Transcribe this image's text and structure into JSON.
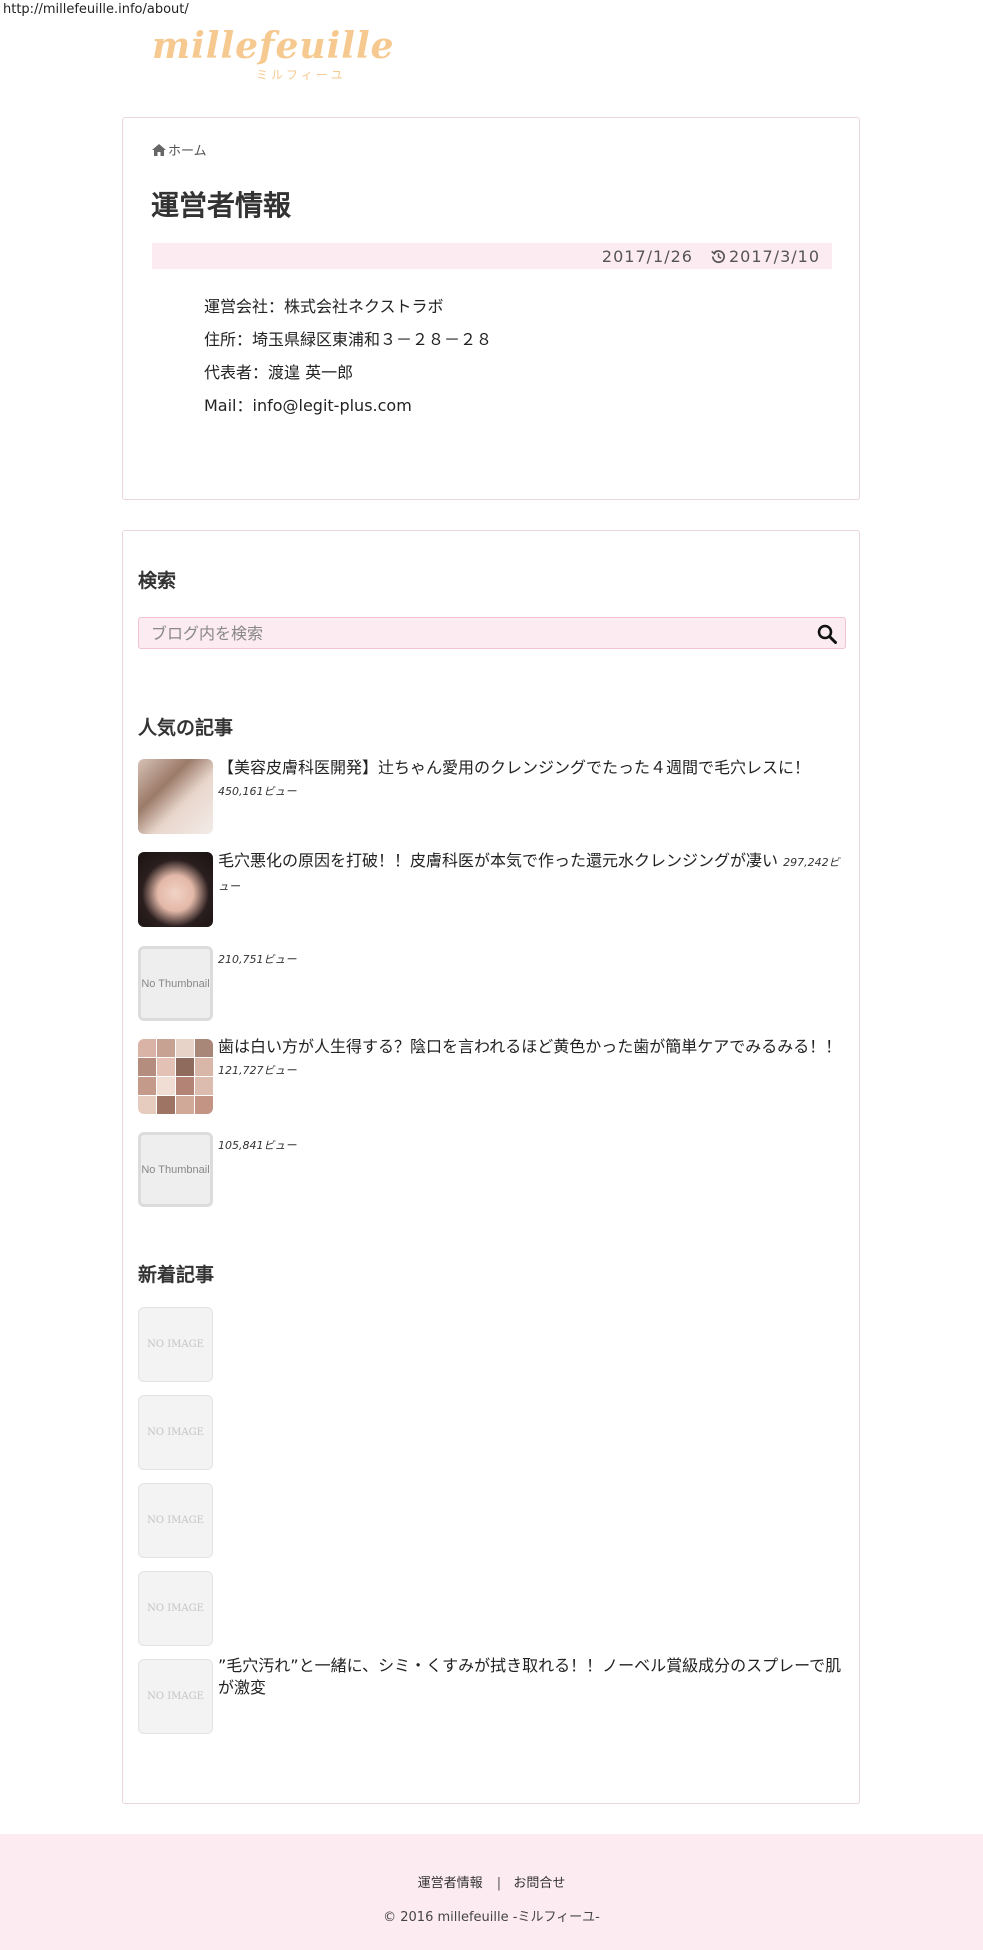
{
  "browser": {
    "url": "http://millefeuille.info/about/"
  },
  "header": {
    "logo_text": "millefeuille",
    "logo_subtitle": "ミルフィーユ"
  },
  "breadcrumb": {
    "home_label": "ホーム"
  },
  "article": {
    "title": "運営者情報",
    "published_date": "2017/1/26",
    "updated_date": "2017/3/10",
    "info": [
      "運営会社：株式会社ネクストラボ",
      "住所：埼玉県緑区東浦和３－２８－２８",
      "代表者：渡遑 英一郎",
      "Mail：info@legit-plus.com"
    ]
  },
  "sidebar": {
    "search": {
      "title": "検索",
      "placeholder": "ブログ内を検索"
    },
    "popular": {
      "title": "人気の記事",
      "items": [
        {
          "title": "【美容皮膚科医開発】辻ちゃん愛用のクレンジングでたった４週間で毛穴レスに！",
          "views": "450,161ビュー"
        },
        {
          "title": "毛穴悪化の原因を打破！！皮膚科医が本気で作った還元水クレンジングが凄い",
          "views": "297,242ビュー"
        },
        {
          "title": "",
          "views": "210,751ビュー",
          "thumb_text": "No Thumbnail"
        },
        {
          "title": "歯は白い方が人生得する？陰口を言われるほど黄色かった歯が簡単ケアでみるみる！！",
          "views": "121,727ビュー"
        },
        {
          "title": "",
          "views": "105,841ビュー",
          "thumb_text": "No Thumbnail"
        }
      ]
    },
    "recent": {
      "title": "新着記事",
      "no_image_label": "NO IMAGE",
      "items": [
        {
          "title": ""
        },
        {
          "title": ""
        },
        {
          "title": ""
        },
        {
          "title": ""
        },
        {
          "title": "”毛穴汚れ”と一緒に、シミ・くすみが拭き取れる！！ノーベル賞級成分のスプレーで肌が激変"
        }
      ]
    }
  },
  "footer": {
    "links": [
      "運営者情報",
      "お問合せ"
    ],
    "separator": "|",
    "copyright": "© 2016 millefeuille -ミルフィーユ-"
  },
  "colors": {
    "accent_pink": "#fcebf0",
    "border_pink": "#f0c3cf",
    "logo": "#f6c990"
  }
}
